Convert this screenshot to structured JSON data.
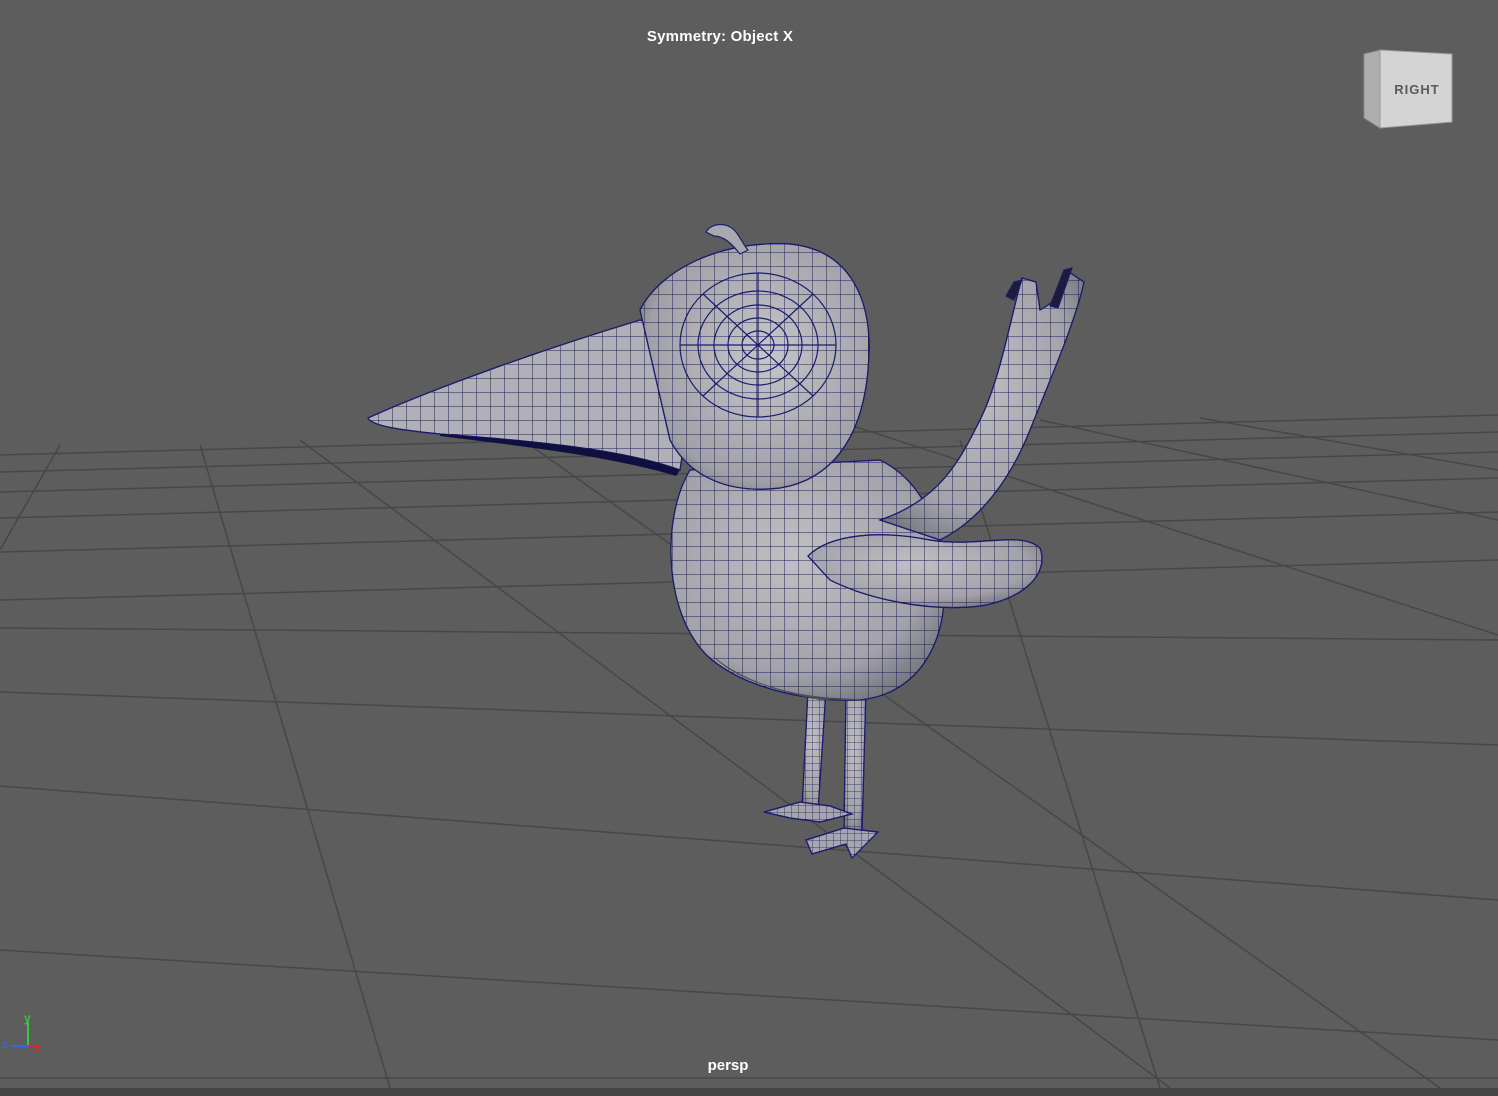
{
  "viewport": {
    "symmetry_label": "Symmetry: Object X",
    "camera_name": "persp",
    "viewcube_face": "RIGHT",
    "axes": {
      "x": "x",
      "y": "y",
      "z": "z"
    }
  },
  "colors": {
    "background": "#5d5d5d",
    "grid": "#474747",
    "mesh_fill": "#a8a8ac",
    "wireframe": "#1c1c6e",
    "axis_x": "#d22b2b",
    "axis_y": "#39c93b",
    "axis_z": "#3a63e0"
  },
  "model": {
    "type": "bird-mesh",
    "display": "wireframe-on-shaded"
  }
}
